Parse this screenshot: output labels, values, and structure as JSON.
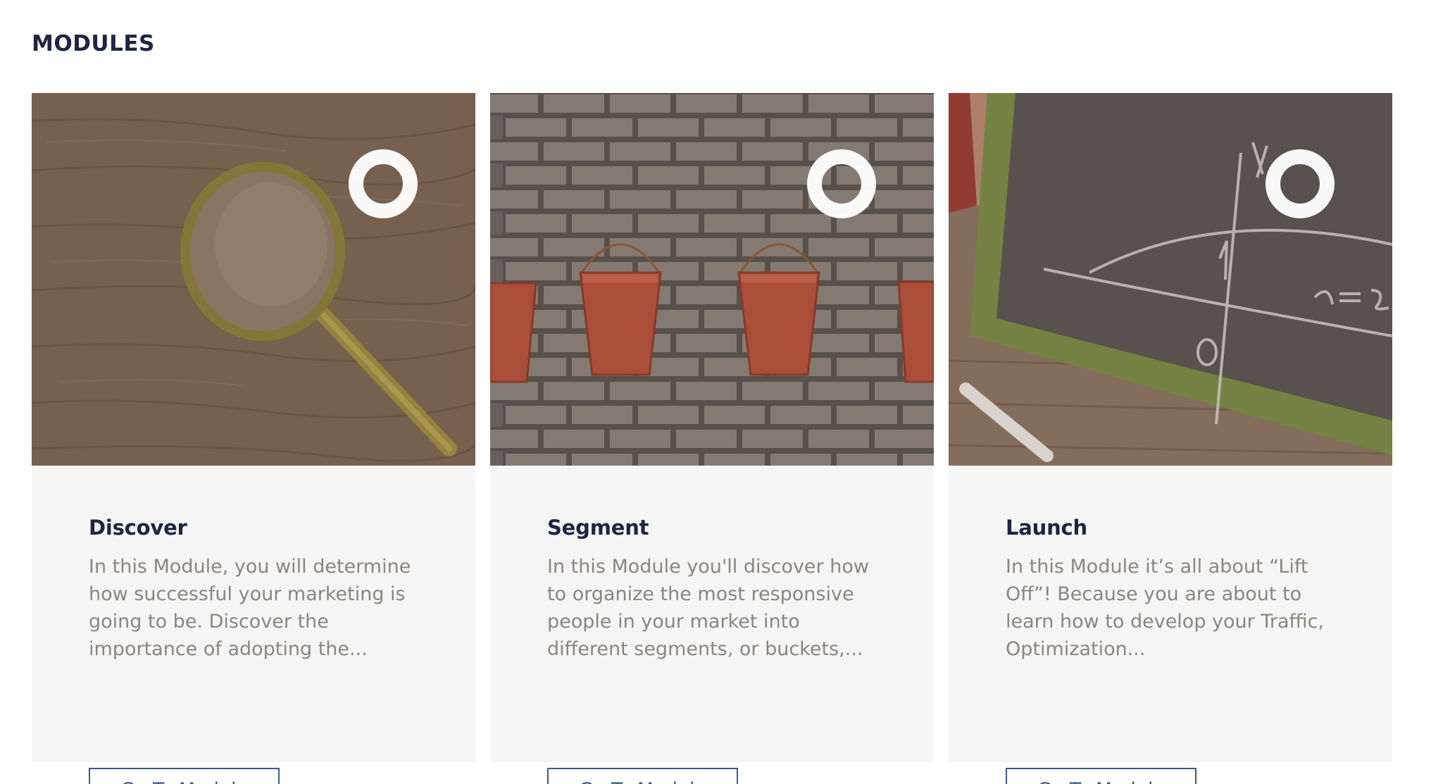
{
  "section": {
    "title": "MODULES"
  },
  "modules": [
    {
      "title": "Discover",
      "description": "In this Module, you will determine how successful your marketing is going to be. Discover the importance of adopting the...",
      "button_label": "Go To Module",
      "image": "magnifying-glass-on-wood"
    },
    {
      "title": "Segment",
      "description": "In this Module you'll discover how to organize the most responsive people in your market into different segments, or buckets,...",
      "button_label": "Go To Module",
      "image": "red-buckets-on-brick-wall"
    },
    {
      "title": "Launch",
      "description": "In this Module it’s all about “Lift Off”! Because you are about to learn how to develop your Traffic, Optimization...",
      "button_label": "Go To Module",
      "image": "chalkboard-with-graph"
    }
  ],
  "colors": {
    "title": "#1c2541",
    "description": "#8b8580",
    "button": "#3a5a8c",
    "card_background": "#f5f5f5"
  }
}
